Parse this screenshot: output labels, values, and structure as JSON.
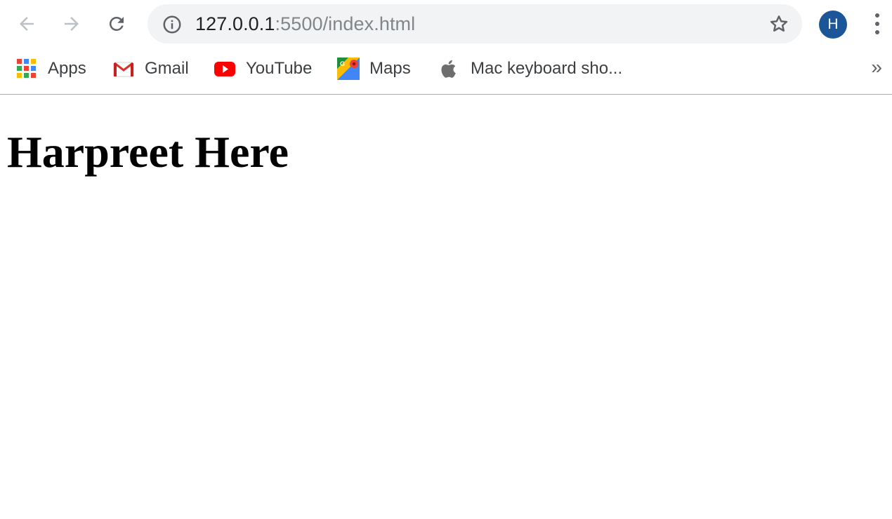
{
  "browser": {
    "nav": {
      "back_icon": "arrow-left-icon",
      "forward_icon": "arrow-right-icon",
      "reload_icon": "reload-icon"
    },
    "address_bar": {
      "host": "127.0.0.1",
      "rest": ":5500/index.html",
      "info_icon": "info-icon",
      "bookmark_star_icon": "star-icon"
    },
    "profile": {
      "initial": "H",
      "color": "#1a5698"
    },
    "menu_icon": "vertical-dots-icon",
    "bookmarks": [
      {
        "label": "Apps",
        "icon": "apps-grid-icon"
      },
      {
        "label": "Gmail",
        "icon": "gmail-icon"
      },
      {
        "label": "YouTube",
        "icon": "youtube-icon"
      },
      {
        "label": "Maps",
        "icon": "maps-icon"
      },
      {
        "label": "Mac keyboard sho...",
        "icon": "apple-icon"
      }
    ],
    "overflow": "»"
  },
  "page": {
    "heading": "Harpreet Here"
  }
}
